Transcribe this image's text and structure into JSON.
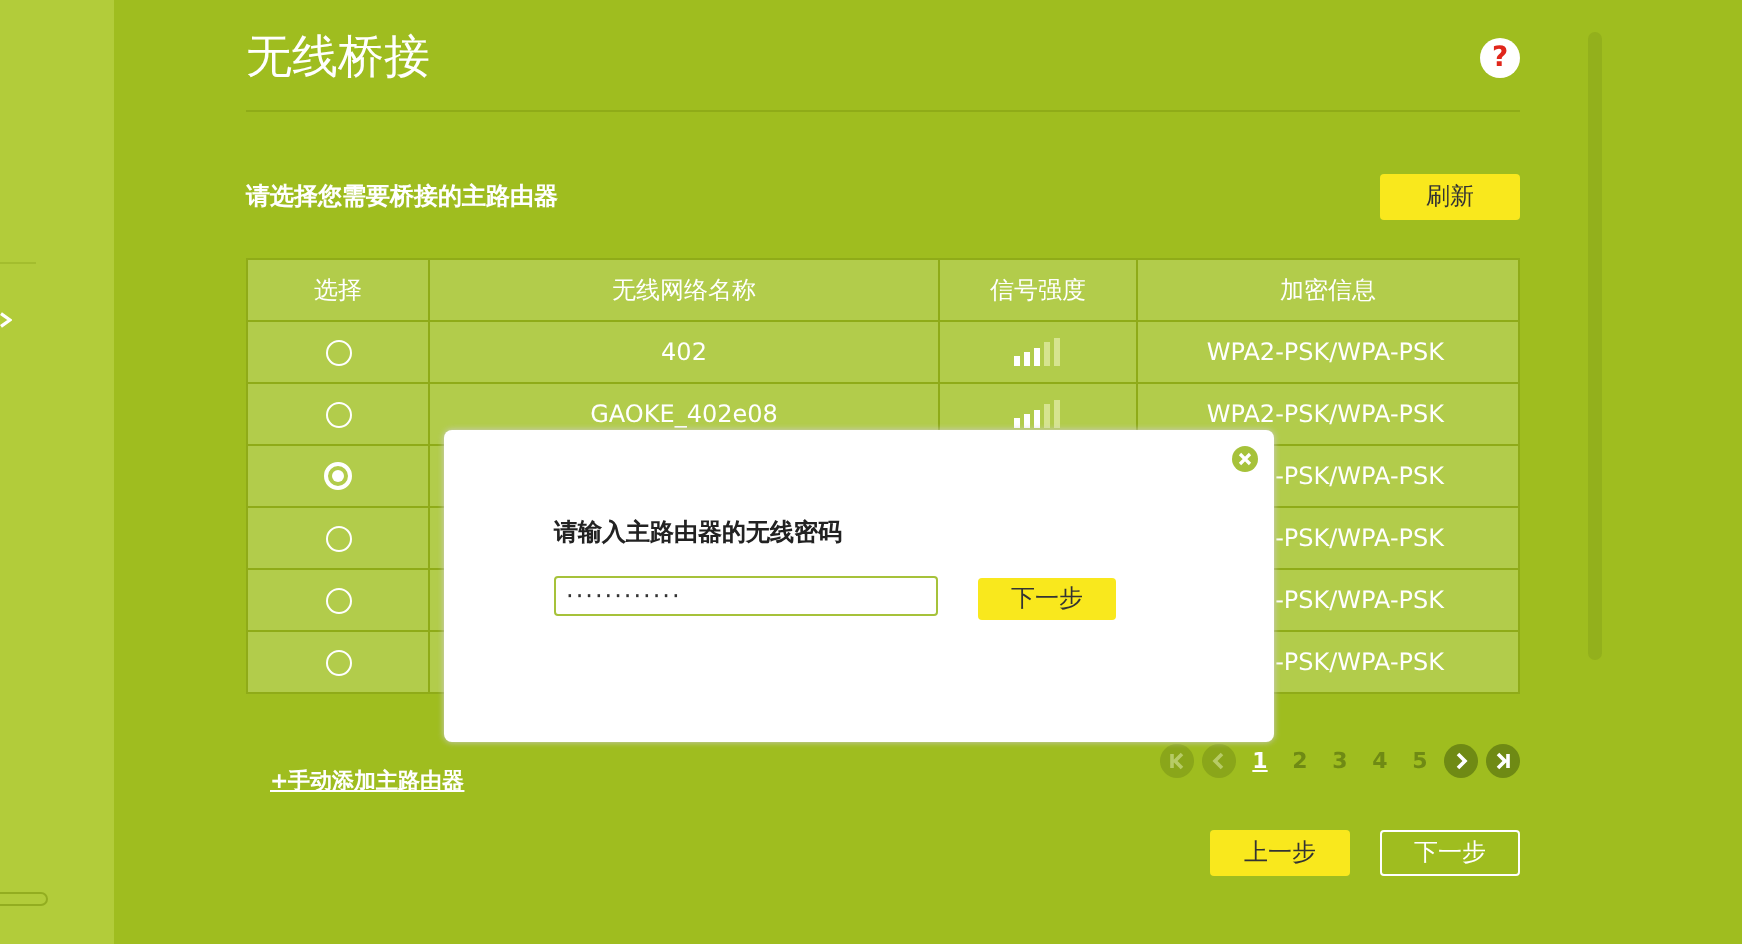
{
  "page": {
    "title": "无线桥接",
    "help": "?"
  },
  "prompt": "请选择您需要桥接的主路由器",
  "refresh_button": "刷新",
  "table": {
    "columns": [
      "选择",
      "无线网络名称",
      "信号强度",
      "加密信息"
    ],
    "rows": [
      {
        "selected": false,
        "name": "402",
        "encryption": "WPA2-PSK/WPA-PSK"
      },
      {
        "selected": false,
        "name": "GAOKE_402e08",
        "encryption": "WPA2-PSK/WPA-PSK"
      },
      {
        "selected": true,
        "encryption": "-PSK/WPA-PSK"
      },
      {
        "selected": false,
        "encryption": "-PSK/WPA-PSK"
      },
      {
        "selected": false,
        "encryption": "-PSK/WPA-PSK"
      },
      {
        "selected": false,
        "encryption": "-PSK/WPA-PSK"
      }
    ]
  },
  "pagination": {
    "pages": [
      {
        "label": "1",
        "selected": true
      },
      {
        "label": "2",
        "selected": false
      },
      {
        "label": "3",
        "selected": false
      },
      {
        "label": "4",
        "selected": false
      },
      {
        "label": "5",
        "selected": false
      }
    ]
  },
  "add_link": "+手动添加主路由器",
  "buttons": [
    {
      "label": "上一步",
      "kind": "primary"
    },
    {
      "label": "下一步",
      "kind": "outline"
    }
  ],
  "dialog": {
    "label": "请输入主路由器的无线密码",
    "value": "············",
    "button": "下一步"
  }
}
